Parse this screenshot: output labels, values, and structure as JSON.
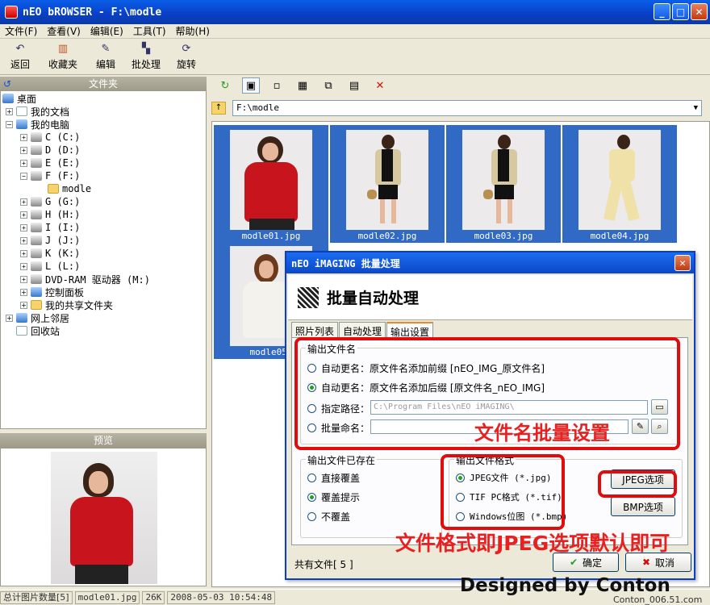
{
  "window": {
    "title": "nEO bROWSER - F:\\modle"
  },
  "menu": [
    "文件(F)",
    "查看(V)",
    "编辑(E)",
    "工具(T)",
    "帮助(H)"
  ],
  "toolbar": [
    {
      "label": "返回",
      "icon": "back-arrow-icon"
    },
    {
      "label": "收藏夹",
      "icon": "favorites-icon"
    },
    {
      "label": "编辑",
      "icon": "edit-icon"
    },
    {
      "label": "批处理",
      "icon": "batch-icon"
    },
    {
      "label": "旋转",
      "icon": "rotate-icon"
    }
  ],
  "folder_pane": {
    "header": "文件夹",
    "tree": [
      {
        "label": "桌面"
      },
      {
        "label": "我的文档"
      },
      {
        "label": "我的电脑"
      },
      {
        "label": "C (C:)"
      },
      {
        "label": "D (D:)"
      },
      {
        "label": "E (E:)"
      },
      {
        "label": "F (F:)"
      },
      {
        "label": "modle"
      },
      {
        "label": "G (G:)"
      },
      {
        "label": "H (H:)"
      },
      {
        "label": "I (I:)"
      },
      {
        "label": "J (J:)"
      },
      {
        "label": "K (K:)"
      },
      {
        "label": "L (L:)"
      },
      {
        "label": "DVD-RAM 驱动器 (M:)"
      },
      {
        "label": "控制面板"
      },
      {
        "label": "我的共享文件夹"
      },
      {
        "label": "网上邻居"
      },
      {
        "label": "回收站"
      }
    ]
  },
  "preview": {
    "header": "预览"
  },
  "path": {
    "value": "F:\\modle"
  },
  "thumbnails": [
    "modle01.jpg",
    "modle02.jpg",
    "modle03.jpg",
    "modle04.jpg",
    "modle05."
  ],
  "status": {
    "count": "总计图片数量[5]",
    "file": "modle01.jpg",
    "size": "26K",
    "date": "2008-05-03 10:54:48"
  },
  "dialog": {
    "title": "nEO iMAGING 批量处理",
    "heading": "批量自动处理",
    "tabs": [
      "照片列表",
      "自动处理",
      "输出设置"
    ],
    "active_tab": "输出设置",
    "output_name": {
      "label": "输出文件名",
      "opt1": "自动更名：原文件名添加前缀 [nEO_IMG_原文件名]",
      "opt2": "自动更名：原文件名添加后缀 [原文件名_nEO_IMG]",
      "opt3": "指定路径：",
      "opt3_value": "C:\\Program Files\\nEO iMAGING\\",
      "opt4": "批量命名：",
      "selected": 2
    },
    "exists": {
      "label": "输出文件已存在",
      "opt1": "直接覆盖",
      "opt2": "覆盖提示",
      "opt3": "不覆盖",
      "selected": 2
    },
    "format": {
      "label": "输出文件格式",
      "opt1": "JPEG文件 (*.jpg)",
      "opt2": "TIF PC格式 (*.tif)",
      "opt3": "Windows位图 (*.bmp)",
      "selected": 1
    },
    "jpeg_btn": "JPEG选项",
    "bmp_btn": "BMP选项",
    "footer": "共有文件[ 5 ]",
    "ok": "确定",
    "cancel": "取消"
  },
  "annotations": {
    "name_hint": "文件名批量设置",
    "format_hint": "文件格式即JPEG选项默认即可"
  },
  "watermark": {
    "main": "Designed by Conton",
    "sub": "Conton_006.51.com"
  },
  "colors": {
    "title_blue": "#0a4fd8",
    "selection_blue": "#316ac5",
    "annotation_red": "#e10c0c"
  }
}
